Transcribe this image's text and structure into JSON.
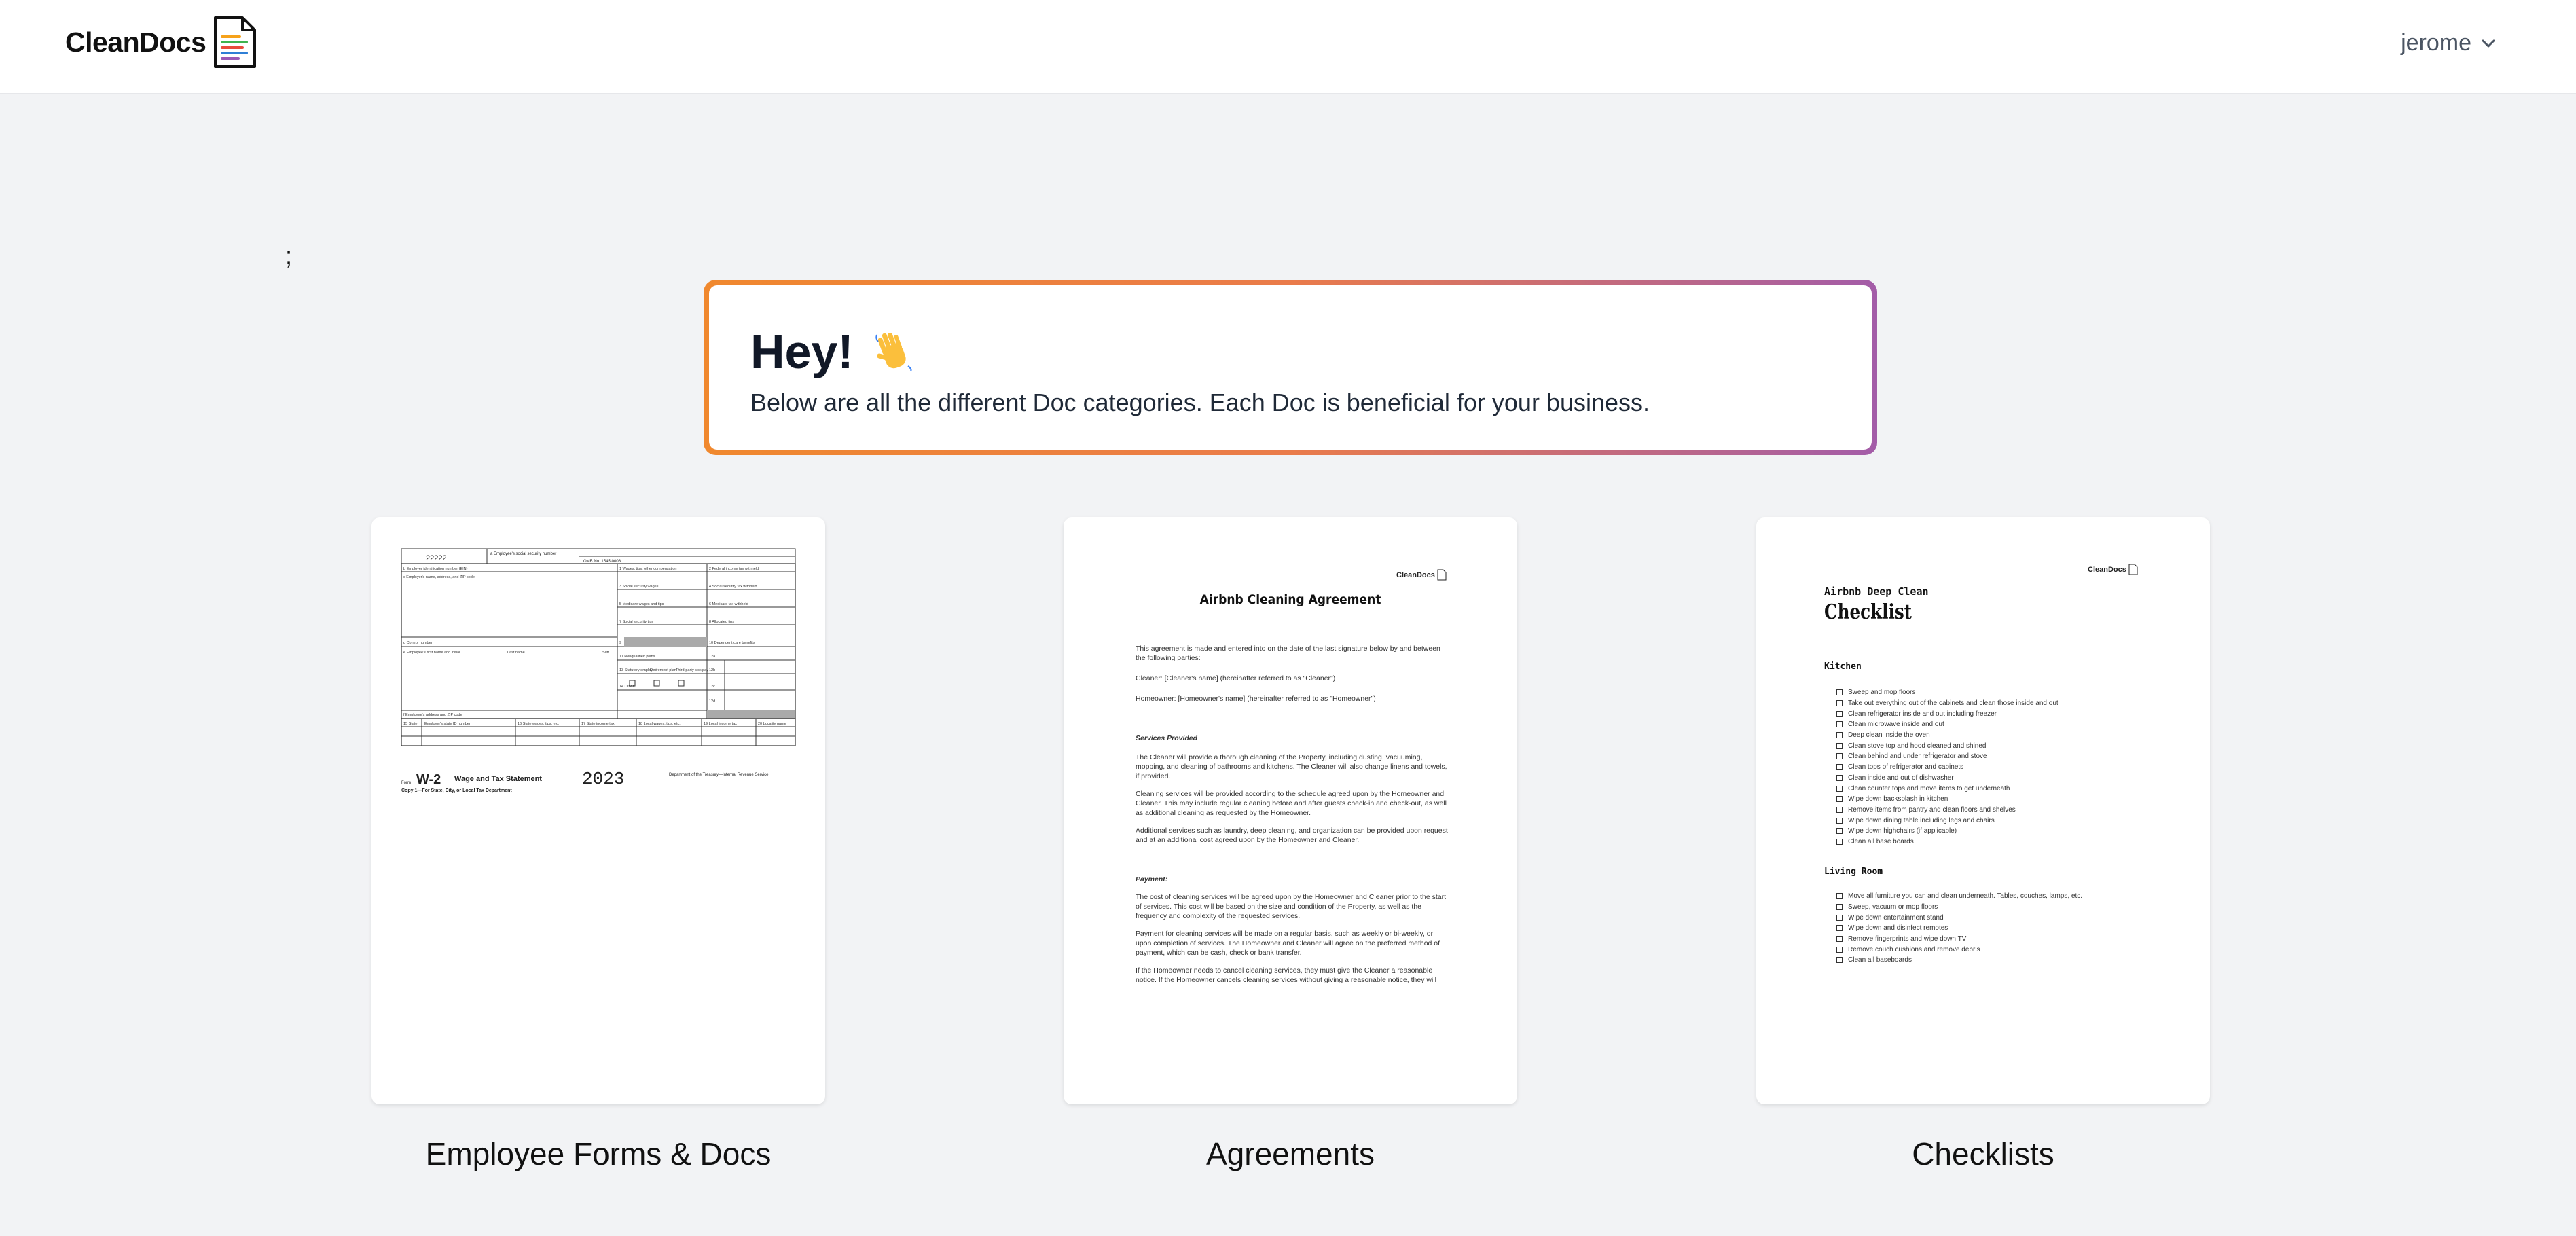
{
  "header": {
    "brand": "CleanDocs",
    "logo_icon": "document-list-icon",
    "user": "jerome",
    "user_chevron_icon": "chevron-down-icon"
  },
  "stray_text": ";",
  "greeting": {
    "title": "Hey!",
    "wave_icon": "waving-hand-icon",
    "subtitle": "Below are all the different Doc categories. Each Doc is beneficial for your business.",
    "gradient": [
      "#f0882e",
      "#a35ca8"
    ]
  },
  "categories": [
    {
      "label": "Employee Forms & Docs",
      "preview": {
        "control": "22222",
        "ssn_label": "a Employee's social security number",
        "omb": "OMB No. 1545-0008",
        "form_name": "W-2",
        "form_title": "Wage and Tax Statement",
        "year": "2023",
        "copy_line": "Copy 1—For State, City, or Local Tax Department",
        "dept": "Department of the Treasury—Internal Revenue Service",
        "form_prefix": "Form",
        "left_fields": [
          "b Employer identification number (EIN)",
          "c Employer's name, address, and ZIP code",
          "d Control number",
          "e Employee's first name and initial",
          "Last name",
          "Suff.",
          "f Employee's address and ZIP code"
        ],
        "box_fields": [
          "1 Wages, tips, other compensation",
          "2 Federal income tax withheld",
          "3 Social security wages",
          "4 Social security tax withheld",
          "5 Medicare wages and tips",
          "6 Medicare tax withheld",
          "7 Social security tips",
          "8 Allocated tips",
          "9",
          "10 Dependent care benefits",
          "11 Nonqualified plans",
          "12a",
          "13 Statutory employee",
          "Retirement plan",
          "Third-party sick pay",
          "12b",
          "14 Other",
          "12c",
          "12d"
        ],
        "state_fields": [
          "15 State",
          "Employer's state ID number",
          "16 State wages, tips, etc.",
          "17 State income tax",
          "18 Local wages, tips, etc.",
          "19 Local income tax",
          "20 Locality name"
        ]
      }
    },
    {
      "label": "Agreements",
      "preview": {
        "brand": "CleanDocs",
        "title": "Airbnb Cleaning Agreement",
        "intro": "This agreement is made and entered into on the date of the last signature below by and between the following parties:",
        "cleaner": "Cleaner: [Cleaner's name] (hereinafter referred to as \"Cleaner\")",
        "homeowner": "Homeowner: [Homeowner's name] (hereinafter referred to as \"Homeowner\")",
        "services_heading": "Services Provided",
        "services_1": "The Cleaner will provide a thorough cleaning of the Property, including dusting, vacuuming, mopping, and cleaning of bathrooms and kitchens. The Cleaner will also change linens and towels, if provided.",
        "services_2": "Cleaning services will be provided according to the schedule agreed upon by the Homeowner and Cleaner. This may include regular cleaning before and after guests check-in and check-out, as well as additional cleaning as requested by the Homeowner.",
        "services_3": "Additional services such as laundry, deep cleaning, and organization can be provided upon request and at an additional cost agreed upon by the Homeowner and Cleaner.",
        "payment_heading": "Payment:",
        "payment_1": "The cost of cleaning services will be agreed upon by the Homeowner and Cleaner prior to the start of services. This cost will be based on the size and condition of the Property, as well as the frequency and complexity of the requested services.",
        "payment_2": "Payment for cleaning services will be made on a regular basis, such as weekly or bi-weekly, or upon completion of services. The Homeowner and Cleaner will agree on the preferred method of payment, which can be cash, check or bank transfer.",
        "payment_3": "If the Homeowner needs to cancel cleaning services, they must give the Cleaner a reasonable notice. If the Homeowner cancels cleaning services without giving a reasonable notice, they will"
      }
    },
    {
      "label": "Checklists",
      "preview": {
        "brand": "CleanDocs",
        "subtitle": "Airbnb Deep Clean",
        "title": "Checklist",
        "kitchen_heading": "Kitchen",
        "kitchen_items": [
          "Sweep and mop floors",
          "Take out everything out of the cabinets and clean those inside and out",
          "Clean refrigerator inside and out including freezer",
          "Clean microwave inside and out",
          "Deep clean inside the oven",
          "Clean stove top and hood cleaned and shined",
          "Clean behind and under refrigerator and stove",
          "Clean tops of refrigerator and cabinets",
          "Clean inside and out of dishwasher",
          "Clean counter tops and move items to get underneath",
          "Wipe down backsplash in kitchen",
          "Remove items from pantry and clean floors and shelves",
          "Wipe down dining table including legs and chairs",
          "Wipe down highchairs (if applicable)",
          "Clean all base boards"
        ],
        "living_heading": "Living Room",
        "living_items": [
          "Move all furniture you can and clean underneath. Tables, couches, lamps, etc.",
          "Sweep, vacuum or mop floors",
          "Wipe down entertainment stand",
          "Wipe down and disinfect remotes",
          "Remove fingerprints and wipe down TV",
          "Remove couch cushions and remove debris",
          "Clean all baseboards"
        ]
      }
    }
  ]
}
